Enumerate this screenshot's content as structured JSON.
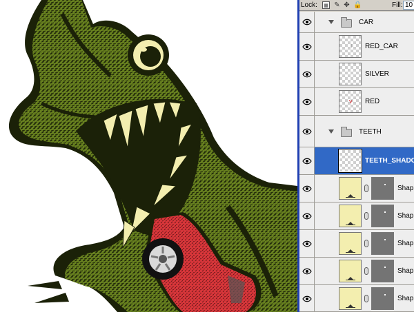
{
  "layers_panel": {
    "lock_label": "Lock:",
    "fill_label": "Fill:",
    "fill_value": "10",
    "layers": [
      {
        "name": "CAR",
        "kind": "group",
        "visible": true
      },
      {
        "name": "RED_CAR",
        "kind": "layer",
        "visible": true,
        "thumb": "transparent"
      },
      {
        "name": "SILVER",
        "kind": "layer",
        "visible": true,
        "thumb": "transparent"
      },
      {
        "name": "RED",
        "kind": "layer",
        "visible": true,
        "thumb": "transparent"
      },
      {
        "name": "TEETH",
        "kind": "group",
        "visible": true
      },
      {
        "name": "TEETH_SHADO",
        "kind": "layer",
        "visible": true,
        "thumb": "transparent",
        "selected": true
      },
      {
        "name": "Shap",
        "kind": "shape",
        "visible": true
      },
      {
        "name": "Shap",
        "kind": "shape",
        "visible": true
      },
      {
        "name": "Shap",
        "kind": "shape",
        "visible": true
      },
      {
        "name": "Shap",
        "kind": "shape",
        "visible": true
      },
      {
        "name": "Shap",
        "kind": "shape",
        "visible": true
      }
    ]
  },
  "colors": {
    "selection": "#3169c6",
    "splitter": "#1f3fb2",
    "panel_bg": "#d4d0c8",
    "dino_green": "#6f8a22",
    "dino_dark": "#1b2108",
    "teeth": "#f3eeaf",
    "car_red": "#d8363a"
  }
}
